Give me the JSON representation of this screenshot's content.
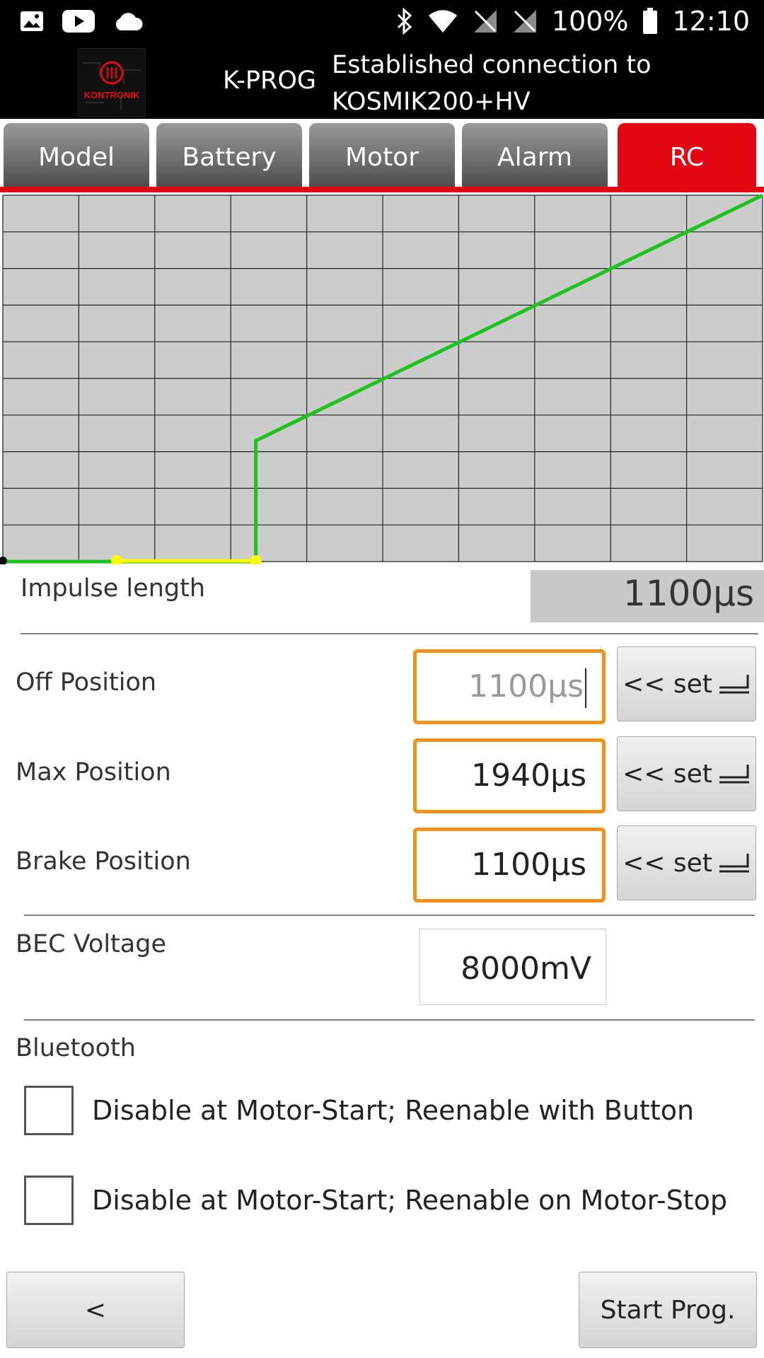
{
  "status_bar": {
    "battery_percent": "100%",
    "time": "12:10",
    "left_icons": [
      "image-icon",
      "youtube-icon",
      "cloud-icon"
    ],
    "right_icons": [
      "bluetooth-icon",
      "wifi-icon",
      "no-sim-icon",
      "no-sim-icon",
      "battery-icon"
    ]
  },
  "header": {
    "logo_text": "KONTRONIK",
    "app_name": "K-PROG",
    "connection_line1": "Established connection to",
    "connection_line2": "KOSMIK200+HV"
  },
  "tabs": [
    {
      "label": "Model",
      "active": false
    },
    {
      "label": "Battery",
      "active": false
    },
    {
      "label": "Motor",
      "active": false
    },
    {
      "label": "Alarm",
      "active": false
    },
    {
      "label": "RC",
      "active": true
    }
  ],
  "colors": {
    "accent": "#e30613",
    "field_border": "#f0921a",
    "curve": "#1ec21e",
    "marker": "#ffff00",
    "chart_bg": "#cccccc"
  },
  "chart_data": {
    "type": "line",
    "title": "",
    "xlabel": "",
    "ylabel": "",
    "grid": true,
    "x_unit": "µs",
    "xlim": [
      0,
      10
    ],
    "ylim": [
      0,
      10
    ],
    "series": [
      {
        "points": [
          [
            0,
            0
          ],
          [
            3.33,
            0
          ],
          [
            3.33,
            3.3
          ],
          [
            10,
            10
          ]
        ]
      }
    ],
    "markers": [
      {
        "x": 1.5,
        "y": 0
      },
      {
        "x": 3.33,
        "y": 0
      }
    ],
    "marker_segment": {
      "x1": 1.5,
      "x2": 3.33
    }
  },
  "impulse": {
    "label": "Impulse length",
    "value": "1100µs"
  },
  "positions": [
    {
      "label": "Off Position",
      "value": "1100µs",
      "placeholder": true,
      "set_label": "<< set"
    },
    {
      "label": "Max Position",
      "value": "1940µs",
      "placeholder": false,
      "set_label": "<< set"
    },
    {
      "label": "Brake Position",
      "value": "1100µs",
      "placeholder": false,
      "set_label": "<< set"
    }
  ],
  "bec": {
    "label": "BEC Voltage",
    "value": "8000mV"
  },
  "bluetooth": {
    "heading": "Bluetooth",
    "options": [
      {
        "label": "Disable at Motor-Start; Reenable with Button",
        "checked": false
      },
      {
        "label": "Disable at Motor-Start; Reenable on Motor-Stop",
        "checked": false
      }
    ]
  },
  "footer": {
    "back_label": "<",
    "start_label": "Start Prog."
  }
}
